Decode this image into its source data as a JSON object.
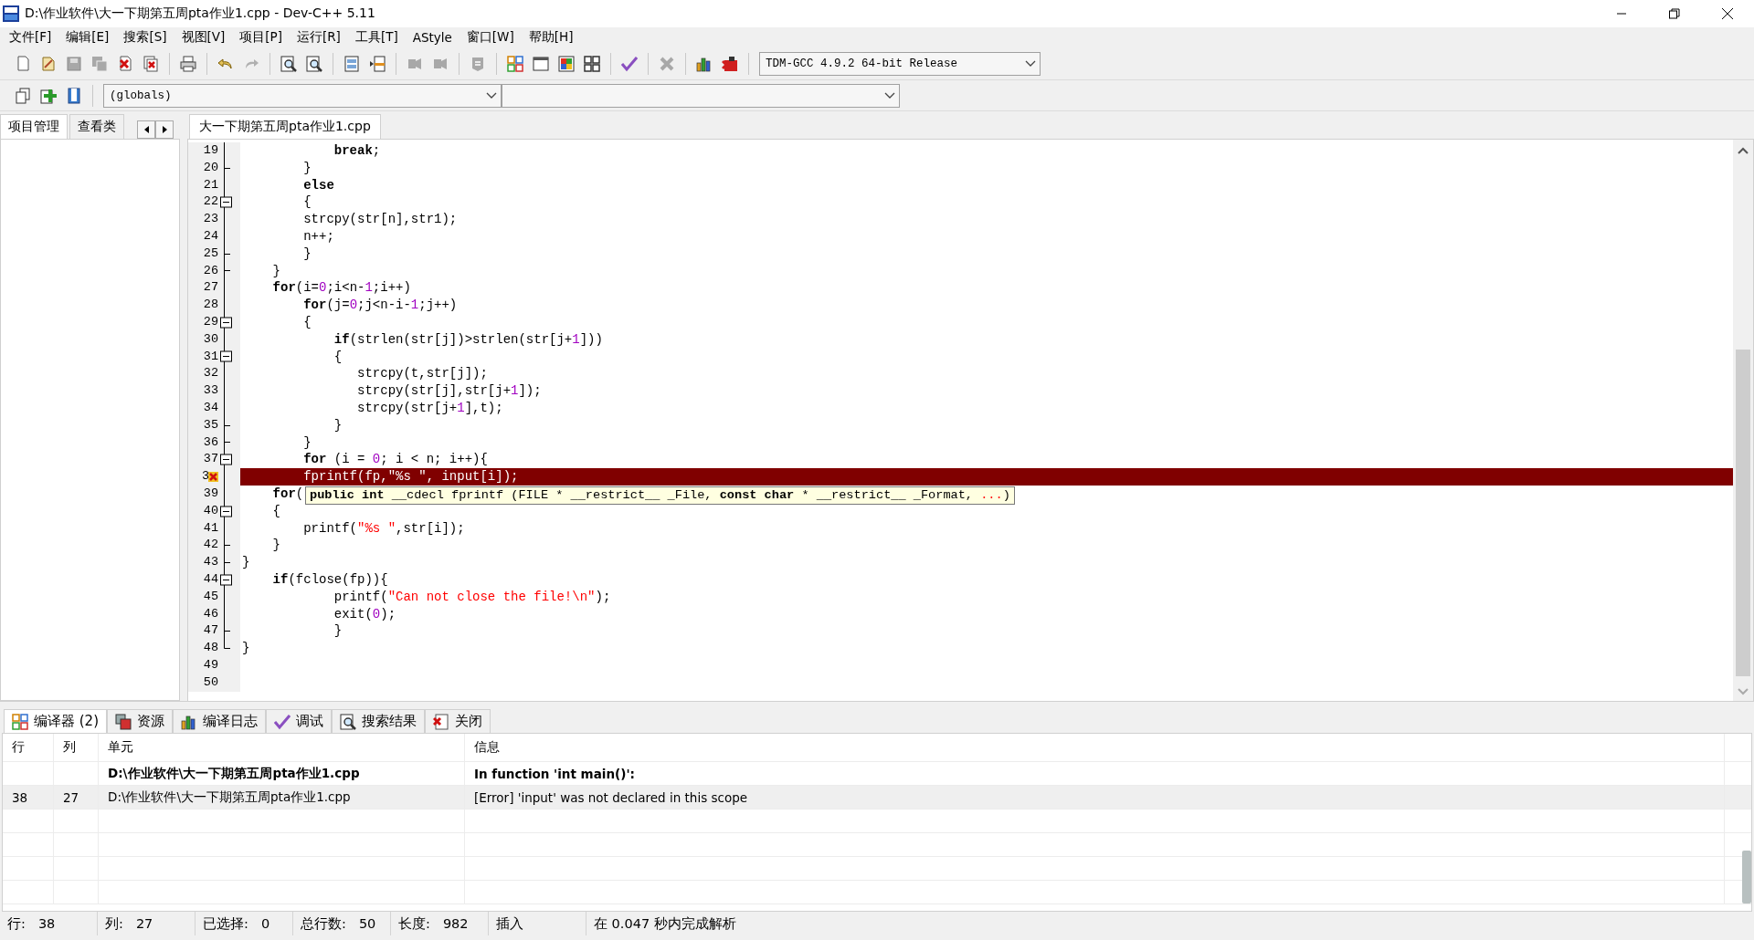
{
  "window": {
    "title": "D:\\作业软件\\大一下期第五周pta作业1.cpp - Dev-C++ 5.11"
  },
  "menu": [
    "文件[F]",
    "编辑[E]",
    "搜索[S]",
    "视图[V]",
    "项目[P]",
    "运行[R]",
    "工具[T]",
    "AStyle",
    "窗口[W]",
    "帮助[H]"
  ],
  "compiler_select": {
    "value": "TDM-GCC 4.9.2 64-bit Release"
  },
  "scope_select": {
    "value": "(globals)"
  },
  "left_tabs": [
    {
      "label": "项目管理",
      "selected": true
    },
    {
      "label": "查看类",
      "selected": false
    }
  ],
  "editor_tabs": [
    {
      "label": "大一下期第五周pta作业1.cpp",
      "selected": true
    }
  ],
  "code_lines": [
    {
      "number": "19",
      "kind": "line",
      "error": false,
      "tokens": [
        {
          "t": "            break",
          "kind": "kw"
        },
        {
          "t": ";"
        }
      ]
    },
    {
      "number": "20",
      "kind": "tick",
      "error": false,
      "tokens": [
        {
          "t": "        }"
        }
      ]
    },
    {
      "number": "21",
      "kind": "line",
      "error": false,
      "tokens": [
        {
          "t": "        else",
          "kind": "kw"
        }
      ]
    },
    {
      "number": "22",
      "kind": "box",
      "error": false,
      "tokens": [
        {
          "t": "        {"
        }
      ]
    },
    {
      "number": "23",
      "kind": "line",
      "error": false,
      "tokens": [
        {
          "t": "        strcpy(str[n],str1);"
        }
      ]
    },
    {
      "number": "24",
      "kind": "line",
      "error": false,
      "tokens": [
        {
          "t": "        n++;"
        }
      ]
    },
    {
      "number": "25",
      "kind": "tick",
      "error": false,
      "tokens": [
        {
          "t": "        }"
        }
      ]
    },
    {
      "number": "26",
      "kind": "tick",
      "error": false,
      "tokens": [
        {
          "t": "    }"
        }
      ]
    },
    {
      "number": "27",
      "kind": "line",
      "error": false,
      "tokens": [
        {
          "t": "    for",
          "kind": "kw"
        },
        {
          "t": "(i="
        },
        {
          "t": "0",
          "kind": "num"
        },
        {
          "t": ";i<n-"
        },
        {
          "t": "1",
          "kind": "num"
        },
        {
          "t": ";i++)"
        }
      ]
    },
    {
      "number": "28",
      "kind": "line",
      "error": false,
      "tokens": [
        {
          "t": "        for",
          "kind": "kw"
        },
        {
          "t": "(j="
        },
        {
          "t": "0",
          "kind": "num"
        },
        {
          "t": ";j<n-i-"
        },
        {
          "t": "1",
          "kind": "num"
        },
        {
          "t": ";j++)"
        }
      ]
    },
    {
      "number": "29",
      "kind": "box",
      "error": false,
      "tokens": [
        {
          "t": "        {"
        }
      ]
    },
    {
      "number": "30",
      "kind": "line",
      "error": false,
      "tokens": [
        {
          "t": "            if",
          "kind": "kw"
        },
        {
          "t": "(strlen(str[j])>strlen(str[j+"
        },
        {
          "t": "1",
          "kind": "num"
        },
        {
          "t": "]))"
        }
      ]
    },
    {
      "number": "31",
      "kind": "box",
      "error": false,
      "tokens": [
        {
          "t": "            {"
        }
      ]
    },
    {
      "number": "32",
      "kind": "line",
      "error": false,
      "tokens": [
        {
          "t": "               strcpy(t,str[j]);"
        }
      ]
    },
    {
      "number": "33",
      "kind": "line",
      "error": false,
      "tokens": [
        {
          "t": "               strcpy(str[j],str[j+"
        },
        {
          "t": "1",
          "kind": "num"
        },
        {
          "t": "]);"
        }
      ]
    },
    {
      "number": "34",
      "kind": "line",
      "error": false,
      "tokens": [
        {
          "t": "               strcpy(str[j+"
        },
        {
          "t": "1",
          "kind": "num"
        },
        {
          "t": "],t);"
        }
      ]
    },
    {
      "number": "35",
      "kind": "tick",
      "error": false,
      "tokens": [
        {
          "t": "            }"
        }
      ]
    },
    {
      "number": "36",
      "kind": "tick",
      "error": false,
      "tokens": [
        {
          "t": "        }"
        }
      ]
    },
    {
      "number": "37",
      "kind": "box",
      "error": false,
      "tokens": [
        {
          "t": "        for",
          "kind": "kw"
        },
        {
          "t": " (i = "
        },
        {
          "t": "0",
          "kind": "num"
        },
        {
          "t": "; i < n; i++){"
        }
      ]
    },
    {
      "number": "3",
      "kind": "line",
      "error": true,
      "tokens": [
        {
          "t": "        fprintf(fp,"
        },
        {
          "t": "\"%s \"",
          "kind": "str"
        },
        {
          "t": ", input[i]);"
        }
      ]
    },
    {
      "number": "39",
      "kind": "line",
      "error": false,
      "tokens": [
        {
          "t": "    for",
          "kind": "kw"
        },
        {
          "t": "("
        }
      ],
      "tooltip": [
        {
          "t": "public int",
          "kind": "kw"
        },
        {
          "t": " __cdecl fprintf (FILE * __restrict__ _File, "
        },
        {
          "t": "const char",
          "kind": "kw"
        },
        {
          "t": " * __restrict__ _Format, "
        },
        {
          "t": "...",
          "kind": "str"
        },
        {
          "t": ")"
        }
      ]
    },
    {
      "number": "40",
      "kind": "box",
      "error": false,
      "tokens": [
        {
          "t": "    {"
        }
      ]
    },
    {
      "number": "41",
      "kind": "line",
      "error": false,
      "tokens": [
        {
          "t": "        printf("
        },
        {
          "t": "\"%s \"",
          "kind": "str"
        },
        {
          "t": ",str[i]);"
        }
      ]
    },
    {
      "number": "42",
      "kind": "tick",
      "error": false,
      "tokens": [
        {
          "t": "    }"
        }
      ]
    },
    {
      "number": "43",
      "kind": "tick",
      "error": false,
      "tokens": [
        {
          "t": "}"
        }
      ]
    },
    {
      "number": "44",
      "kind": "box",
      "error": false,
      "tokens": [
        {
          "t": "    if",
          "kind": "kw"
        },
        {
          "t": "(fclose(fp)){"
        }
      ]
    },
    {
      "number": "45",
      "kind": "line",
      "error": false,
      "tokens": [
        {
          "t": "            printf("
        },
        {
          "t": "\"Can not close the file!\\n\"",
          "kind": "str"
        },
        {
          "t": ");"
        }
      ]
    },
    {
      "number": "46",
      "kind": "line",
      "error": false,
      "tokens": [
        {
          "t": "            exit("
        },
        {
          "t": "0",
          "kind": "num"
        },
        {
          "t": ");"
        }
      ]
    },
    {
      "number": "47",
      "kind": "tick",
      "error": false,
      "tokens": [
        {
          "t": "            }"
        }
      ]
    },
    {
      "number": "48",
      "kind": "last",
      "error": false,
      "tokens": [
        {
          "t": "}"
        }
      ]
    },
    {
      "number": "49",
      "kind": "none",
      "error": false
    },
    {
      "number": "50",
      "kind": "none",
      "error": false
    }
  ],
  "bottom_tabs": [
    {
      "label": "编译器 (2)",
      "selected": true
    },
    {
      "label": "资源",
      "selected": false
    },
    {
      "label": "编译日志",
      "selected": false
    },
    {
      "label": "调试",
      "selected": false
    },
    {
      "label": "搜索结果",
      "selected": false
    },
    {
      "label": "关闭",
      "selected": false
    }
  ],
  "messages": {
    "columns": [
      "行",
      "列",
      "单元",
      "信息"
    ],
    "rows": [
      {
        "bold": true,
        "selected": false,
        "cells": [
          "",
          "",
          "D:\\作业软件\\大一下期第五周pta作业1.cpp",
          "In function 'int main()':"
        ]
      },
      {
        "bold": false,
        "selected": true,
        "cells": [
          "38",
          "27",
          "D:\\作业软件\\大一下期第五周pta作业1.cpp",
          "[Error] 'input' was not declared in this scope"
        ]
      }
    ]
  },
  "status_bar": [
    {
      "label": "行:",
      "value": "38"
    },
    {
      "label": "列:",
      "value": "27"
    },
    {
      "label": "已选择:",
      "value": "0"
    },
    {
      "label": "总行数:",
      "value": "50"
    },
    {
      "label": "长度:",
      "value": "982"
    },
    {
      "value": "插入"
    },
    {
      "value": "在 0.047 秒内完成解析"
    }
  ]
}
